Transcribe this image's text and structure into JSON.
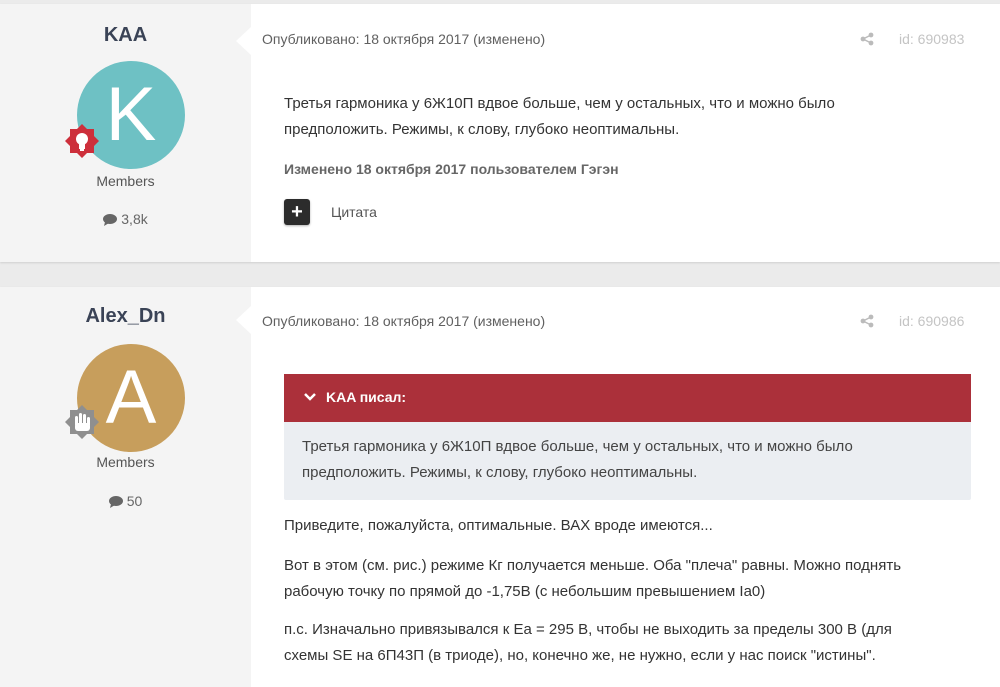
{
  "colors": {
    "avatar_kaa": "#6ec1c4",
    "avatar_alex": "#c79e5c",
    "quote_header": "#ab303a",
    "badge_red": "#cd2f3b",
    "badge_gray": "#8f8f8f"
  },
  "posts": [
    {
      "author": {
        "name": "KAA",
        "avatar_letter": "K",
        "group": "Members",
        "reputation_icon": "comment-icon",
        "count": "3,8k",
        "badge_icon": "lightbulb-icon"
      },
      "meta": {
        "published": "Опубликовано: 18 октября 2017 (изменено)",
        "share_icon": "share-icon",
        "id": "id: 690983"
      },
      "body": {
        "lines": [
          "Третья гармоника у 6Ж10П вдвое больше, чем у остальных, что и можно было",
          "предположить. Режимы, к слову, глубоко неоптимальны."
        ],
        "edited": "Изменено 18 октября 2017 пользователем Гэгэн"
      },
      "quote_button": {
        "icon": "+",
        "label": "Цитата"
      }
    },
    {
      "author": {
        "name": "Alex_Dn",
        "avatar_letter": "A",
        "group": "Members",
        "reputation_icon": "comment-icon",
        "count": "50",
        "badge_icon": "hand-icon"
      },
      "meta": {
        "published": "Опубликовано: 18 октября 2017 (изменено)",
        "share_icon": "share-icon",
        "id": "id: 690986"
      },
      "quote": {
        "header": "KAA писал:",
        "lines": [
          "Третья гармоника у 6Ж10П вдвое больше, чем у остальных, что и можно было",
          "предположить. Режимы, к слову, глубоко неоптимальны."
        ]
      },
      "paragraphs": [
        [
          "Приведите, пожалуйста, оптимальные. ВАХ вроде имеются..."
        ],
        [
          "Вот в этом (см. рис.) режиме Кг получается меньше. Оба \"плеча\" равны. Можно поднять",
          "рабочую точку по прямой до -1,75В (с небольшим превышением Ia0)"
        ],
        [
          "п.с. Изначально привязывался к Еа = 295 В, чтобы не выходить за пределы 300 В (для",
          "схемы SE на 6П43П (в триоде), но, конечно же, не нужно, если у нас поиск \"истины\"."
        ]
      ]
    }
  ]
}
